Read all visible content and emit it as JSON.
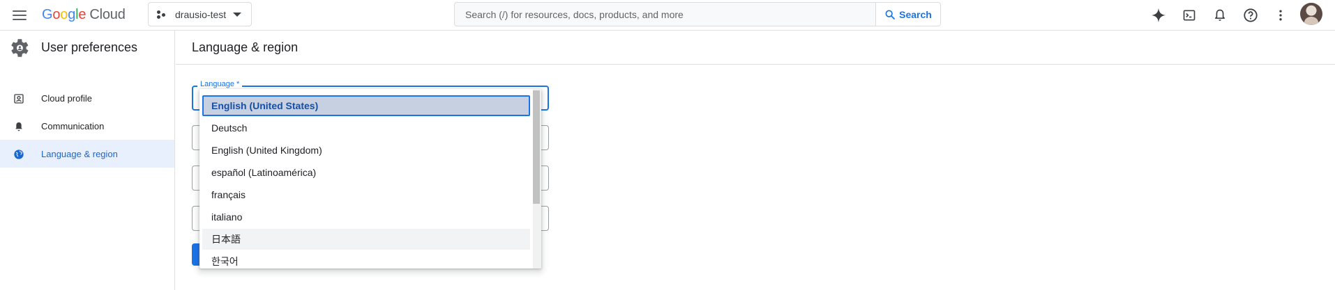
{
  "topbar": {
    "logo": {
      "word1_letters": [
        "G",
        "o",
        "o",
        "g",
        "l",
        "e"
      ],
      "word2": "Cloud"
    },
    "project": {
      "name": "drausio-test"
    },
    "search": {
      "placeholder": "Search (/) for resources, docs, products, and more",
      "button_label": "Search"
    },
    "icons": [
      "gemini-icon",
      "cloud-shell-icon",
      "notifications-icon",
      "help-icon",
      "more-vert-icon",
      "account-avatar"
    ]
  },
  "sidebar": {
    "title": "User preferences",
    "items": [
      {
        "label": "Cloud profile",
        "icon": "profile-icon",
        "active": false
      },
      {
        "label": "Communication",
        "icon": "bell-icon",
        "active": false
      },
      {
        "label": "Language & region",
        "icon": "globe-icon",
        "active": true
      }
    ]
  },
  "main": {
    "title": "Language & region",
    "language_field_label": "Language *"
  },
  "dropdown": {
    "options": [
      {
        "label": "English (United States)",
        "state": "selected"
      },
      {
        "label": "Deutsch",
        "state": "normal"
      },
      {
        "label": "English (United Kingdom)",
        "state": "normal"
      },
      {
        "label": "español (Latinoamérica)",
        "state": "normal"
      },
      {
        "label": "français",
        "state": "normal"
      },
      {
        "label": "italiano",
        "state": "normal"
      },
      {
        "label": "日本語",
        "state": "hover"
      },
      {
        "label": "한국어",
        "state": "normal"
      }
    ]
  },
  "colors": {
    "accent": "#1a73e8",
    "active_bg": "#e8f0fe",
    "border": "#dadce0"
  }
}
